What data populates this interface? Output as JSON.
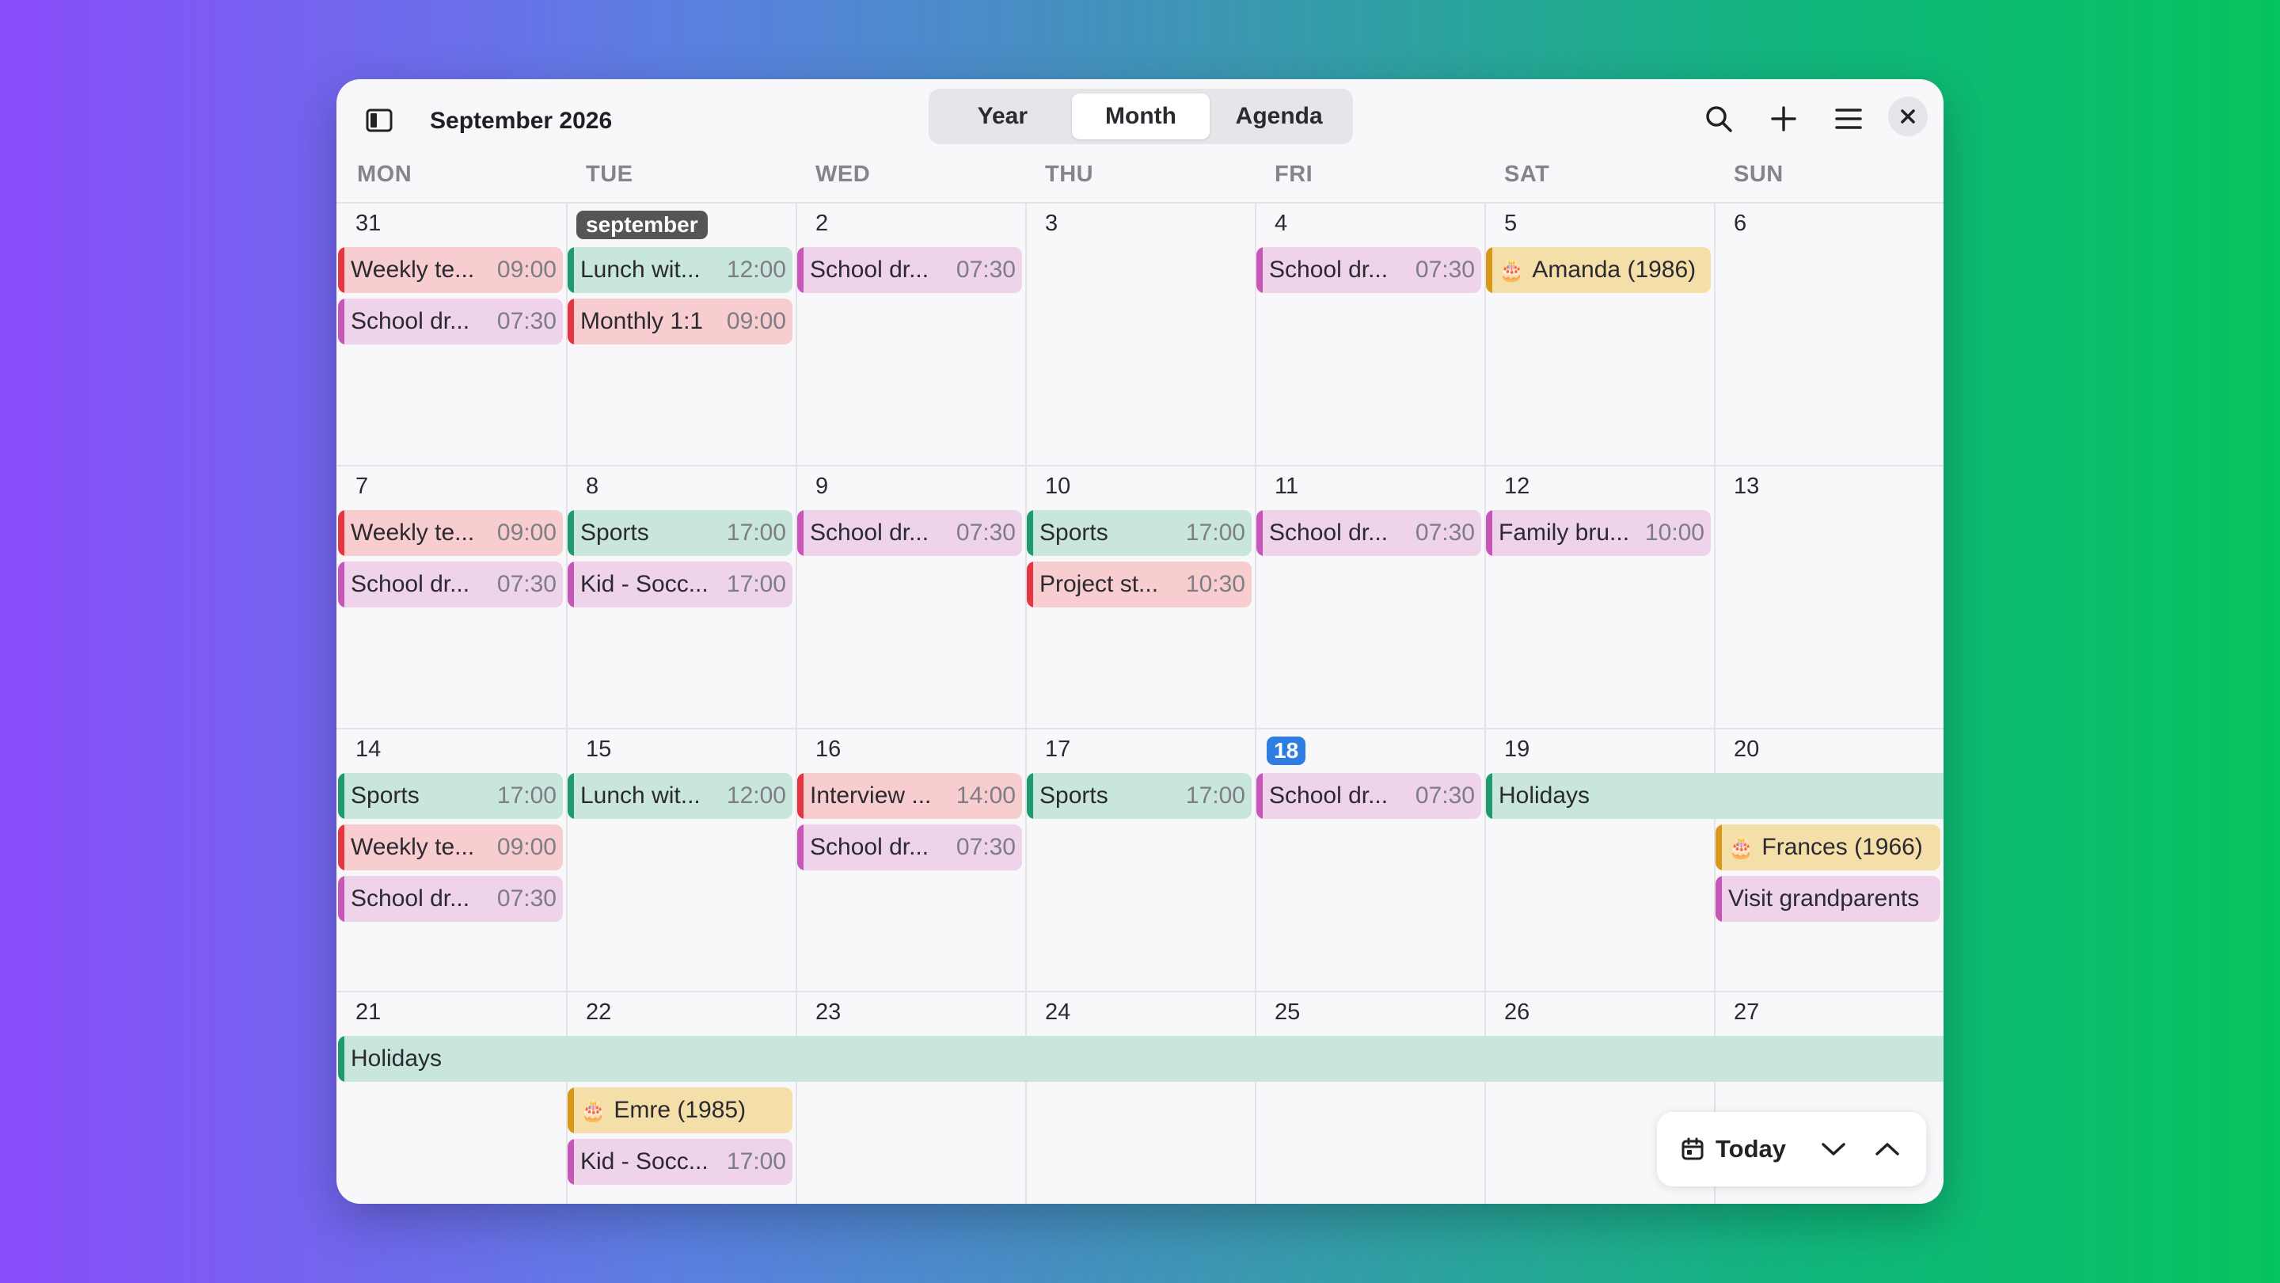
{
  "header": {
    "title": "September 2026",
    "views": [
      {
        "label": "Year",
        "active": false
      },
      {
        "label": "Month",
        "active": true
      },
      {
        "label": "Agenda",
        "active": false
      }
    ]
  },
  "weekdays": [
    "MON",
    "TUE",
    "WED",
    "THU",
    "FRI",
    "SAT",
    "SUN"
  ],
  "weeks": [
    [
      "31",
      "september",
      "2",
      "3",
      "4",
      "5",
      "6"
    ],
    [
      "7",
      "8",
      "9",
      "10",
      "11",
      "12",
      "13"
    ],
    [
      "14",
      "15",
      "16",
      "17",
      "18",
      "19",
      "20"
    ],
    [
      "21",
      "22",
      "23",
      "24",
      "25",
      "26",
      "27"
    ]
  ],
  "events": {
    "w1": {
      "mon1": {
        "title": "Weekly te...",
        "time": "09:00"
      },
      "mon2": {
        "title": "School dr...",
        "time": "07:30"
      },
      "tue1": {
        "title": "Lunch wit...",
        "time": "12:00"
      },
      "tue2": {
        "title": "Monthly 1:1",
        "time": "09:00"
      },
      "wed1": {
        "title": "School dr...",
        "time": "07:30"
      },
      "fri1": {
        "title": "School dr...",
        "time": "07:30"
      },
      "sat1": {
        "title": "Amanda (1986)"
      }
    },
    "w2": {
      "mon1": {
        "title": "Weekly te...",
        "time": "09:00"
      },
      "mon2": {
        "title": "School dr...",
        "time": "07:30"
      },
      "tue1": {
        "title": "Sports",
        "time": "17:00"
      },
      "tue2": {
        "title": "Kid - Socc...",
        "time": "17:00"
      },
      "wed1": {
        "title": "School dr...",
        "time": "07:30"
      },
      "thu1": {
        "title": "Sports",
        "time": "17:00"
      },
      "thu2": {
        "title": "Project st...",
        "time": "10:30"
      },
      "fri1": {
        "title": "School dr...",
        "time": "07:30"
      },
      "sat1": {
        "title": "Family bru...",
        "time": "10:00"
      }
    },
    "w3": {
      "mon1": {
        "title": "Sports",
        "time": "17:00"
      },
      "mon2": {
        "title": "Weekly te...",
        "time": "09:00"
      },
      "mon3": {
        "title": "School dr...",
        "time": "07:30"
      },
      "tue1": {
        "title": "Lunch wit...",
        "time": "12:00"
      },
      "wed1": {
        "title": "Interview ...",
        "time": "14:00"
      },
      "wed2": {
        "title": "School dr...",
        "time": "07:30"
      },
      "thu1": {
        "title": "Sports",
        "time": "17:00"
      },
      "fri1": {
        "title": "School dr...",
        "time": "07:30"
      },
      "satsun": {
        "title": "Holidays"
      },
      "sun1": {
        "title": "Frances (1966)"
      },
      "sun2": {
        "title": "Visit grandparents"
      }
    },
    "w4": {
      "all": {
        "title": "Holidays"
      },
      "tue1": {
        "title": "Emre (1985)"
      },
      "tue2": {
        "title": "Kid - Socc...",
        "time": "17:00"
      }
    }
  },
  "today_controls": {
    "label": "Today"
  },
  "colors": {
    "work": "#e53540",
    "family": "#c855b8",
    "personal": "#1f9a6f",
    "birthday": "#d9981a",
    "today_highlight": "#2f7de1"
  }
}
